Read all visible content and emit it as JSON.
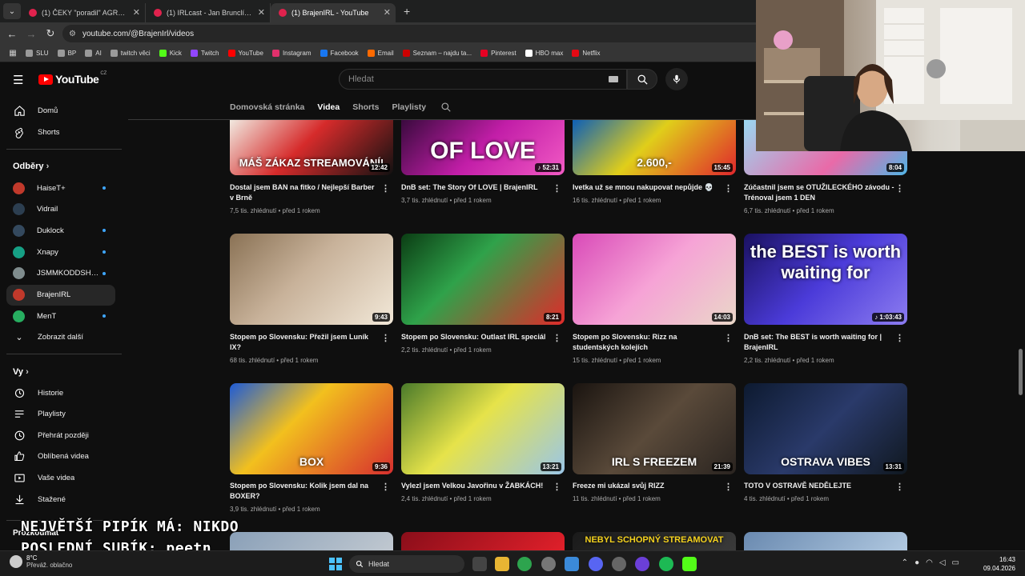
{
  "browser": {
    "tabs": [
      {
        "title": "(1) ČEKY \"poradil\" AGRAELOVI"
      },
      {
        "title": "(1) IRLcast - Jan Brunclík: TRPÍM"
      },
      {
        "title": "(1) BrajenIRL - YouTube"
      }
    ],
    "url": "youtube.com/@BrajenIrl/videos",
    "bookmarks": [
      {
        "label": "SLU",
        "color": "#9a9a9a"
      },
      {
        "label": "BP",
        "color": "#9a9a9a"
      },
      {
        "label": "AI",
        "color": "#9a9a9a"
      },
      {
        "label": "twitch věci",
        "color": "#9a9a9a"
      },
      {
        "label": "Kick",
        "color": "#53fc18"
      },
      {
        "label": "Twitch",
        "color": "#9146ff"
      },
      {
        "label": "YouTube",
        "color": "#ff0000"
      },
      {
        "label": "Instagram",
        "color": "#e1306c"
      },
      {
        "label": "Facebook",
        "color": "#1877f2"
      },
      {
        "label": "Email",
        "color": "#ff6a00"
      },
      {
        "label": "Seznam – najdu ta...",
        "color": "#cc0000"
      },
      {
        "label": "Pinterest",
        "color": "#e60023"
      },
      {
        "label": "HBO max",
        "color": "#ffffff"
      },
      {
        "label": "Netflix",
        "color": "#e50914"
      }
    ]
  },
  "youtube": {
    "logo_text": "YouTube",
    "region": "CZ",
    "search_placeholder": "Hledat",
    "channel_tabs": [
      "Domovská stránka",
      "Videa",
      "Shorts",
      "Playlisty"
    ],
    "active_tab": "Videa"
  },
  "sidebar": {
    "main": [
      {
        "label": "Domů",
        "icon": "home-icon"
      },
      {
        "label": "Shorts",
        "icon": "shorts-icon"
      }
    ],
    "subscriptions_title": "Odběry",
    "subscriptions": [
      {
        "label": "HaiseT+",
        "color": "#c0392b",
        "dot": true
      },
      {
        "label": "Vidrail",
        "color": "#2c3e50",
        "dot": false
      },
      {
        "label": "Duklock",
        "color": "#34495e",
        "dot": true
      },
      {
        "label": "Xnapy",
        "color": "#16a085",
        "dot": true
      },
      {
        "label": "JSMMKODDSHO...",
        "color": "#7f8c8d",
        "dot": true
      },
      {
        "label": "BrajenIRL",
        "color": "#c0392b",
        "dot": false,
        "active": true
      },
      {
        "label": "MenT",
        "color": "#27ae60",
        "dot": true
      }
    ],
    "show_more": "Zobrazit další",
    "you_title": "Vy",
    "you": [
      {
        "label": "Historie",
        "icon": "history-icon"
      },
      {
        "label": "Playlisty",
        "icon": "playlists-icon"
      },
      {
        "label": "Přehrát později",
        "icon": "watch-later-icon"
      },
      {
        "label": "Oblíbená videa",
        "icon": "liked-icon"
      },
      {
        "label": "Vaše videa",
        "icon": "your-videos-icon"
      },
      {
        "label": "Stažené",
        "icon": "downloads-icon"
      }
    ],
    "explore_title": "Prozkoumat"
  },
  "videos": [
    {
      "title": "Dostal jsem BAN na fitko / Nejlepší Barber v Brně",
      "views": "7,5 tis. zhlédnutí",
      "age": "před 1 rokem",
      "duration": "12:42",
      "thumb_text": "MÁŠ ZÁKAZ STREAMOVÁNÍ!"
    },
    {
      "title": "DnB set: The Story Of LOVE | BrajenIRL",
      "views": "3,7 tis. zhlédnutí",
      "age": "před 1 rokem",
      "duration": "♪ 52:31",
      "thumb_text": "OF LOVE"
    },
    {
      "title": "Ivetka už se mnou nakupovat nepůjde 💀",
      "views": "16 tis. zhlédnutí",
      "age": "před 1 rokem",
      "duration": "15:45",
      "thumb_text": "2.600,-"
    },
    {
      "title": "Zúčastnil jsem se OTUŽILECKÉHO závodu - Trénoval jsem 1 DEN",
      "views": "6,7 tis. zhlédnutí",
      "age": "před 1 rokem",
      "duration": "8:04",
      "thumb_text": ""
    },
    {
      "title": "Stopem po Slovensku: Přežil jsem Luník IX?",
      "views": "68 tis. zhlédnutí",
      "age": "před 1 rokem",
      "duration": "9:43",
      "thumb_text": ""
    },
    {
      "title": "Stopem po Slovensku: Outlast IRL speciál",
      "views": "2,2 tis. zhlédnutí",
      "age": "před 1 rokem",
      "duration": "8:21",
      "thumb_text": ""
    },
    {
      "title": "Stopem po Slovensku: Rizz na studentských kolejích",
      "views": "15 tis. zhlédnutí",
      "age": "před 1 rokem",
      "duration": "14:03",
      "thumb_text": ""
    },
    {
      "title": "DnB set: The BEST is worth waiting for | BrajenIRL",
      "views": "2,2 tis. zhlédnutí",
      "age": "před 1 rokem",
      "duration": "♪ 1:03:43",
      "thumb_text": "the BEST is worth waiting for"
    },
    {
      "title": "Stopem po Slovensku: Kolik jsem dal na BOXER?",
      "views": "3,9 tis. zhlédnutí",
      "age": "před 1 rokem",
      "duration": "9:36",
      "thumb_text": "BOX"
    },
    {
      "title": "Vylezl jsem Velkou Javořinu v ŽABKÁCH!",
      "views": "2,4 tis. zhlédnutí",
      "age": "před 1 rokem",
      "duration": "13:21",
      "thumb_text": ""
    },
    {
      "title": "Freeze mi ukázal svůj RIZZ",
      "views": "11 tis. zhlédnutí",
      "age": "před 1 rokem",
      "duration": "21:39",
      "thumb_text": "IRL S FREEZEM"
    },
    {
      "title": "TOTO V OSTRAVĚ NEDĚLEJTE",
      "views": "4 tis. zhlédnutí",
      "age": "před 1 rokem",
      "duration": "13:31",
      "thumb_text": "OSTRAVA VIBES"
    },
    {
      "title": "",
      "views": "",
      "age": "",
      "duration": "",
      "thumb_text": ""
    },
    {
      "title": "",
      "views": "",
      "age": "",
      "duration": "",
      "thumb_text": ""
    },
    {
      "title": "",
      "views": "",
      "age": "",
      "duration": "",
      "thumb_text": "NEBYL SCHOPNÝ STREAMOVAT"
    },
    {
      "title": "",
      "views": "",
      "age": "",
      "duration": "",
      "thumb_text": ""
    }
  ],
  "overlay": {
    "line1": "NEJVĚTŠÍ PIPÍK MÁ: NIKDO",
    "line2": "POSLEDNÍ SUBÍK: peetn"
  },
  "taskbar": {
    "temperature": "8°C",
    "weather": "Převáž. oblačno",
    "search": "Hledat",
    "time": "16:43",
    "date": "09.04.2026"
  }
}
